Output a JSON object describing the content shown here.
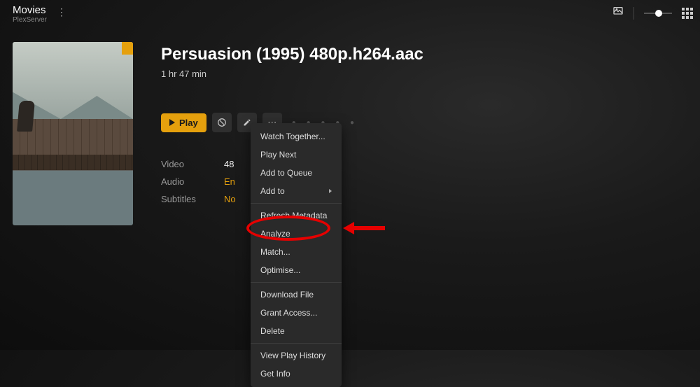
{
  "header": {
    "library": "Movies",
    "server": "PlexServer"
  },
  "movie": {
    "title": "Persuasion (1995) 480p.h264.aac",
    "duration": "1 hr 47 min"
  },
  "actions": {
    "play": "Play"
  },
  "meta": {
    "video_label": "Video",
    "video_value": "48",
    "audio_label": "Audio",
    "audio_value": "En",
    "subs_label": "Subtitles",
    "subs_value": "No"
  },
  "menu": {
    "watch_together": "Watch Together...",
    "play_next": "Play Next",
    "add_queue": "Add to Queue",
    "add_to": "Add to",
    "refresh": "Refresh Metadata",
    "analyze": "Analyze",
    "match": "Match...",
    "optimise": "Optimise...",
    "download": "Download File",
    "grant": "Grant Access...",
    "delete": "Delete",
    "history": "View Play History",
    "getinfo": "Get Info"
  }
}
